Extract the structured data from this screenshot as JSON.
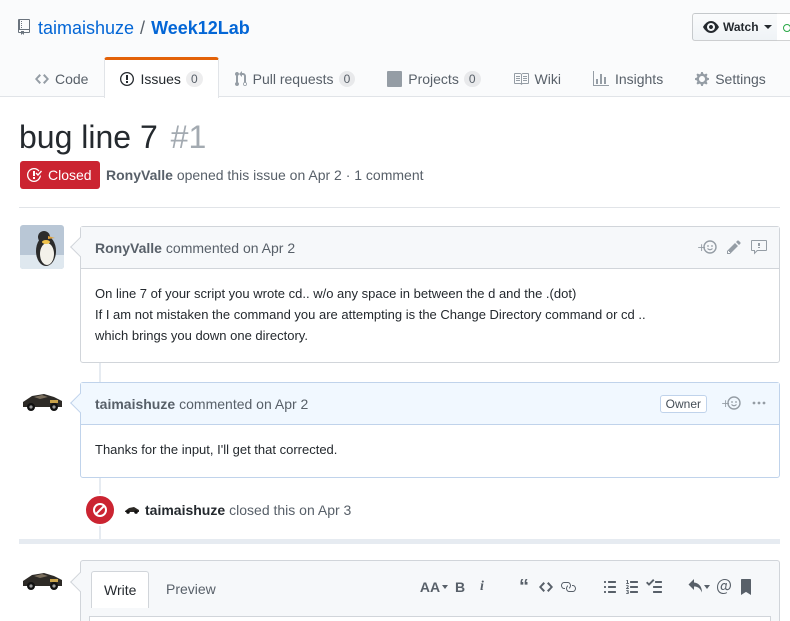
{
  "repo": {
    "owner": "taimaishuze",
    "separator": "/",
    "name": "Week12Lab"
  },
  "watch": {
    "label": "Watch"
  },
  "nav": {
    "tabs": [
      {
        "label": "Code",
        "icon": "code-icon"
      },
      {
        "label": "Issues",
        "count": "0",
        "icon": "issue-opened-icon",
        "selected": true
      },
      {
        "label": "Pull requests",
        "count": "0",
        "icon": "git-pull-request-icon"
      },
      {
        "label": "Projects",
        "count": "0",
        "icon": "project-icon"
      },
      {
        "label": "Wiki",
        "icon": "book-icon"
      },
      {
        "label": "Insights",
        "icon": "graph-icon"
      },
      {
        "label": "Settings",
        "icon": "gear-icon"
      }
    ]
  },
  "issue": {
    "title": "bug line 7",
    "number": "#1",
    "state": "Closed",
    "author": "RonyValle",
    "meta": "opened this issue on Apr 2 · 1 comment"
  },
  "comments": [
    {
      "author": "RonyValle",
      "meta": "commented on Apr 2",
      "lines": [
        "On line 7 of your script you wrote cd.. w/o any space in between the d and the .(dot)",
        "If I am not mistaken the command you are attempting is the Change Directory command or cd ..",
        "which brings you down one directory."
      ]
    },
    {
      "author": "taimaishuze",
      "meta": "commented on Apr 2",
      "label": "Owner",
      "lines": [
        "Thanks for the input, I'll get that corrected."
      ]
    }
  ],
  "event": {
    "author": "taimaishuze",
    "text": "closed this on Apr 3"
  },
  "composer": {
    "tabs": {
      "write": "Write",
      "preview": "Preview"
    },
    "toolbar": {
      "header": "AA",
      "bold": "B",
      "italic": "i",
      "quote": "“"
    }
  },
  "colors": {
    "link": "#0366d6",
    "closed": "#cb2431",
    "tab_accent": "#e36209",
    "owner_border": "#c0d3eb"
  }
}
